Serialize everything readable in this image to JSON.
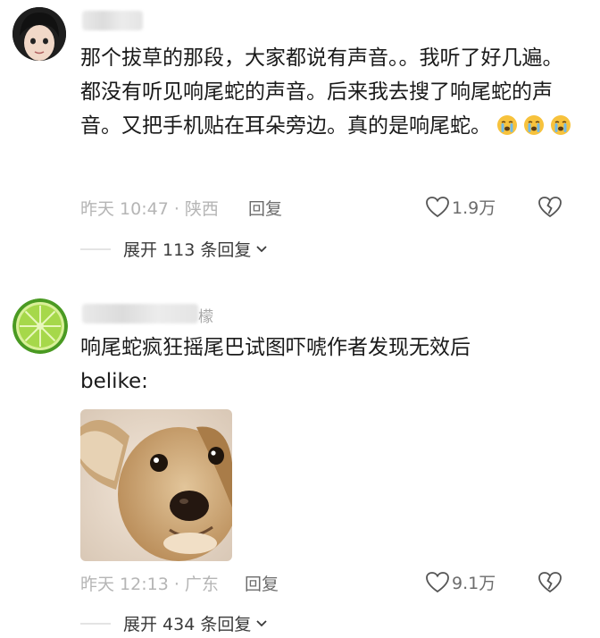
{
  "comments": [
    {
      "text": "那个拔草的那段，大家都说有声音。。我听了好几遍。都没有听见响尾蛇的声音。后来我去搜了响尾蛇的声音。又把手机贴在耳朵旁边。真的是响尾蛇。",
      "emoji_icon": "crying-face-icon",
      "time_location": "昨天 10:47 · 陕西",
      "reply_label": "回复",
      "likes": "1.9万",
      "expand_label": "展开 113 条回复"
    },
    {
      "username_tail": "檬",
      "text_line1": "响尾蛇疯狂摇尾巴试图吓唬作者发现无效后",
      "text_line2": "belike:",
      "time_location": "昨天 12:13 · 广东",
      "reply_label": "回复",
      "likes": "9.1万",
      "expand_label": "展开 434 条回复"
    }
  ],
  "colors": {
    "meta_gray": "#b5b5b5",
    "action_gray": "#6c6c6c",
    "text": "#1a1a1a",
    "emoji_yellow": "#f7c23c",
    "lime_green": "#7cc132"
  }
}
